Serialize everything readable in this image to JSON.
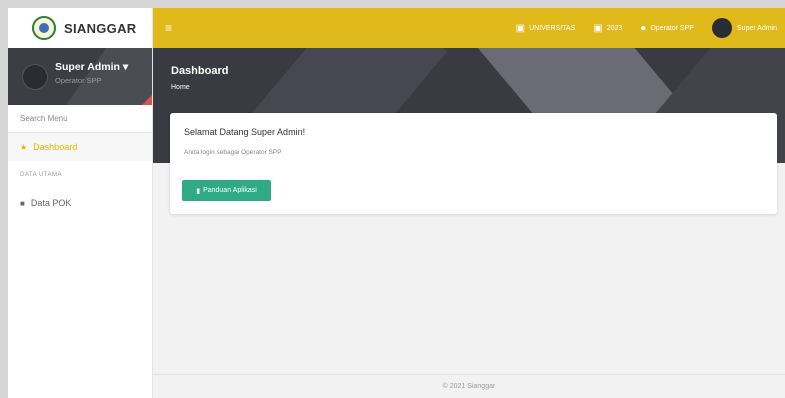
{
  "brand": {
    "name": "SIANGGAR"
  },
  "user_panel": {
    "name": "Super Admin ▾",
    "role": "Operator SPP"
  },
  "sidebar": {
    "search_placeholder": "Search Menu",
    "dashboard_label": "Dashboard",
    "section_label": "DATA UTAMA",
    "data_pok_label": "Data POK"
  },
  "navbar": {
    "org_label": "UNIVERSITAS",
    "year_label": "2023",
    "role_label": "Operator SPP",
    "user_label": "Super Admin"
  },
  "header": {
    "title": "Dashboard",
    "breadcrumb": "Home"
  },
  "card": {
    "title": "Selamat Datang Super Admin!",
    "subtitle": "Anda login sebagai Operator SPP",
    "button_label": "Panduan Aplikasi"
  },
  "footer": {
    "text": "© 2021 Sianggar"
  },
  "colors": {
    "accent": "#e0b91b",
    "button": "#2faa86",
    "dark": "#3a3a42"
  }
}
